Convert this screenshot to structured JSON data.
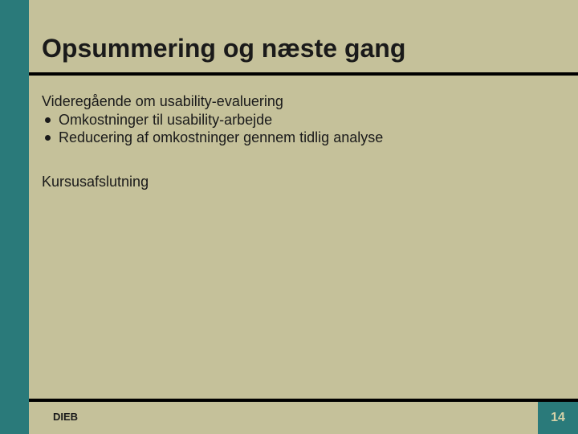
{
  "slide": {
    "title": "Opsummering og næste gang",
    "section1": {
      "heading": "Videregående om usability-evaluering",
      "bullets": [
        "Omkostninger til usability-arbejde",
        "Reducering af omkostninger gennem tidlig analyse"
      ]
    },
    "section2": {
      "heading": "Kursusafslutning"
    }
  },
  "footer": {
    "left": "DIEB",
    "page": "14"
  },
  "colors": {
    "background": "#c5c19a",
    "accent": "#2a7a7a",
    "text": "#1a1a1a"
  }
}
